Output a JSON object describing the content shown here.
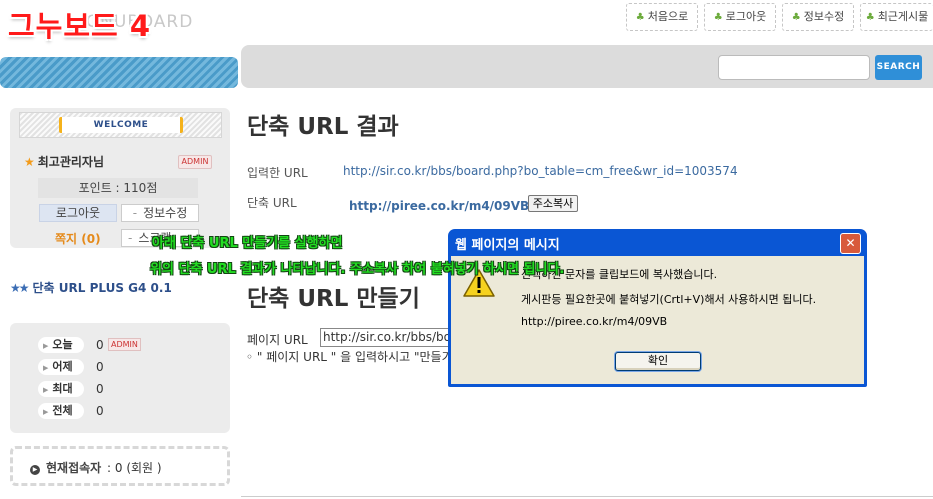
{
  "brand": {
    "title": "그누보드 4",
    "subtitle": "GNUBOARD"
  },
  "top_nav": [
    "처음으로",
    "로그아웃",
    "정보수정",
    "최근게시물"
  ],
  "search": {
    "button": "SEARCH",
    "value": ""
  },
  "sidebar": {
    "welcome": "WELCOME",
    "user": "최고관리자님",
    "admin_badge": "ADMIN",
    "points": "포인트 : 110점",
    "logout": "로그아웃",
    "edit_info": "정보수정",
    "memo": "쪽지 (0)",
    "scrap": "스크랩",
    "plugin": "단축 URL PLUS G4 0.1",
    "stats": [
      {
        "label": "오늘",
        "value": "0"
      },
      {
        "label": "어제",
        "value": "0"
      },
      {
        "label": "최대",
        "value": "0"
      },
      {
        "label": "전체",
        "value": "0"
      }
    ],
    "stats_admin": "ADMIN",
    "current_label": "현재접속자",
    "current_value": ": 0 (회원 )"
  },
  "main": {
    "result_title": "단축 URL 결과",
    "input_label": "입력한 URL",
    "input_value": "http://sir.co.kr/bbs/board.php?bo_table=cm_free&wr_id=1003574",
    "short_label": "단축 URL",
    "short_value": "http://piree.co.kr/m4/09VB",
    "copy_button": "주소복사",
    "make_title": "단축 URL 만들기",
    "page_label": "페이지 URL",
    "page_value": "http://sir.co.kr/bbs/board.php?bo_table=cm_free&wr_id=1003574",
    "help_text": "◦ \" 페이지 URL \" 을 입력하시고 \"만들기\" 버튼을 클릭하세요."
  },
  "annotations": {
    "line1": "아래 단축 URL 만들기를 실행하면",
    "line2": "위의 단축 URL 결과가 나타납니다. 주소복사 하여 붙혀넣기 하시면 됩니다."
  },
  "dialog": {
    "title": "웹 페이지의 메시지",
    "line1": "선택하신 문자를 클립보드에 복사했습니다.",
    "line2": "게시판등 필요한곳에 붙혀넣기(Crtl+V)해서 사용하시면 됩니다.",
    "line3": "http://piree.co.kr/m4/09VB",
    "ok": "확인",
    "close": "✕"
  }
}
